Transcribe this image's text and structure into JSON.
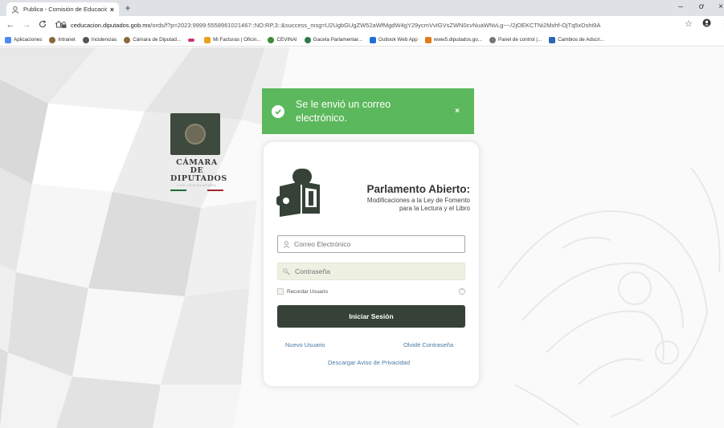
{
  "browser": {
    "tab_title": "Publica - Comisión de Educación",
    "tab_close": "×",
    "new_tab": "+",
    "minimize": "–",
    "maximize": "ơ",
    "close": "×",
    "url_host": "ceducacion.diputados.gob.mx",
    "url_path": "/ords/f?p=2023:9999:5558961021467::NO:RP,3::&success_msg=U2UgbGUgZW52aWfMgdW4gY29ycmVvIGVsZWN0cvNuaWNvLg~~/2jOEKCTNi2Mxhf-OjTq5xDshi9A",
    "bookmarks": [
      {
        "label": "Aplicaciones",
        "color": "#4a8af4"
      },
      {
        "label": "Intranet",
        "color": "#8b6a3a"
      },
      {
        "label": "Incidencias",
        "color": "#555555"
      },
      {
        "label": "Cámara de Diputad...",
        "color": "#8b6a3a"
      },
      {
        "label": "",
        "color": "#c8347a"
      },
      {
        "label": "Mi Facturas | Oficin...",
        "color": "#e8a21c"
      },
      {
        "label": "CEVINAI",
        "color": "#3c8a3c"
      },
      {
        "label": "Gaceta Parlamentar...",
        "color": "#2f7a4d"
      },
      {
        "label": "Outlook Web App",
        "color": "#1e6fd9"
      },
      {
        "label": "www5.diputados.go...",
        "color": "#e27c1a"
      },
      {
        "label": "Panel de control |...",
        "color": "#777777"
      },
      {
        "label": "Cambios de Adscri...",
        "color": "#2f66b3"
      }
    ]
  },
  "logo": {
    "line1": "CÁMARA DE",
    "line2": "DIPUTADOS",
    "sub": "LXV LEGISLATURA",
    "colors": {
      "green": "#1f6b3a",
      "red": "#a4262c"
    }
  },
  "toast": {
    "message": "Se le envió un correo electrónico.",
    "close": "×",
    "color": "#5cb85c"
  },
  "card": {
    "title": "Parlamento Abierto:",
    "subtitle_line1": "Modificaciones a la Ley de Fomento",
    "subtitle_line2": "para la Lectura y el Libro",
    "email_placeholder": "Correo Electrónico",
    "password_placeholder": "Contraseña",
    "remember_label": "Recordar Usuario",
    "help": "?",
    "login_button": "Iniciar Sesión",
    "new_user_link": "Nuevo Usuario",
    "forgot_link": "Olvidé Contraseña",
    "privacy_link": "Descargar Aviso de Privacidad",
    "accent": "#364237"
  }
}
